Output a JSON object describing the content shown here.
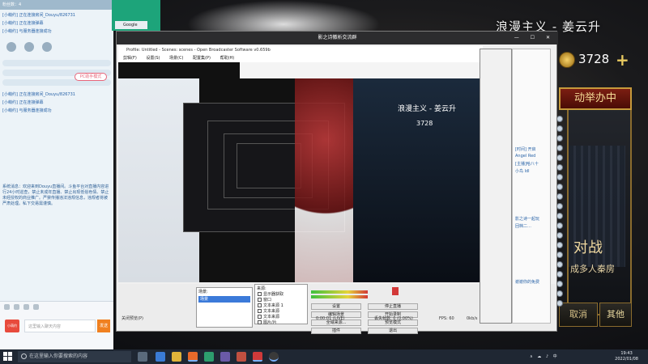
{
  "background_game": {
    "title": "浪漫主义 - 姜云升",
    "gold": "3728",
    "plus": "+",
    "banner": "动举办中",
    "battle": "对战",
    "room": "成多人秦房",
    "cancel": "取消",
    "other": "其他"
  },
  "chat": {
    "top_bar": "粉丝数：4",
    "items": [
      "[小萌约] 正在连接房间_Douyu/826731",
      "[小萌约] 正在连接弹幕",
      "[小萌约] 与服务器连接成功"
    ],
    "pc_mode": "PC助手模式",
    "items2": [
      "[小萌约] 正在连接房间_Douyu/826731",
      "[小萌约] 正在连接弹幕",
      "[小萌约] 与服务器连接成功"
    ],
    "notice": "系统消息：欢迎来到Douyu直播间。斗鱼平台对直播内容进行24小时巡查，禁止未成年直播、禁止出现低俗色情、禁止未经授权的商业推广。严禁传播违法违规信息，违规者将被严肃处理。私下交易需谨慎。",
    "input_placeholder": "这里输入聊天内容",
    "send": "发送",
    "avatar_label": "小萌约"
  },
  "obs": {
    "window_title": "影之诗徽析交流群",
    "inner_title": "Profile: Untitled - Scenes: scenes - Open Broadcaster Software v0.659b",
    "menu": [
      "剪辑(F)",
      "设置(S)",
      "场景(C)",
      "配置集(P)",
      "帮助(H)"
    ],
    "preview_title": "浪漫主义 - 姜云升",
    "preview_gold": "3728",
    "scenes_label": "场景:",
    "scene_item": "场景",
    "sources_label": "来源:",
    "sources": [
      "显示器获取",
      "窗口",
      "文本来源 1",
      "文本来源",
      "文本来源",
      "图片/片",
      "捕获"
    ],
    "buttons": {
      "settings": "设置",
      "stop_live": "停止直播",
      "edit_scene": "编辑场景",
      "start_record": "开始录制",
      "global_sources": "全域来源...",
      "preview_only": "预览模式",
      "plugins": "插件",
      "exit": "退出"
    },
    "status": {
      "preview": "关闭预览(P)",
      "time": "0:00:01 (LIVE)",
      "dropped": "丢失帧数: 0 (0.00%)",
      "fps": "FPS: 60",
      "kbps": "0kb/s"
    }
  },
  "right_frames": [
    "[时间] 开启",
    "Angel Red",
    "[主播]哈八十",
    "小鸟 ldl",
    "影之诗一起玩",
    "回档二…",
    "谢谢你的免费"
  ],
  "taskbar": {
    "search_placeholder": "在这里输入你要搜索的内容",
    "time": "19:43",
    "date": "2022/01/08",
    "lang": "中"
  }
}
